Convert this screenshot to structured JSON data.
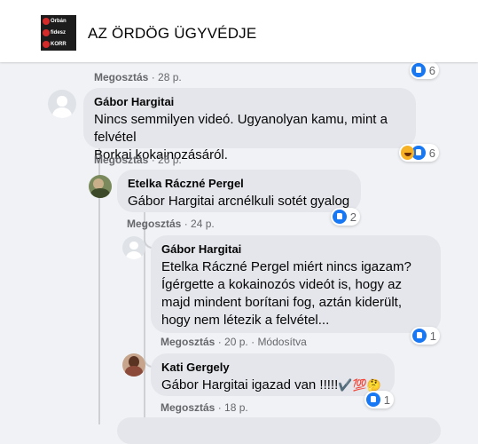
{
  "header": {
    "title": "AZ ÖRDÖG ÜGYVÉDJE",
    "logo_texts": [
      "Orbán",
      "fidesz",
      "KORR"
    ]
  },
  "comments": [
    {
      "meta": {
        "action": "Megosztás",
        "time": "28 p."
      },
      "reactions": {
        "count": "6"
      }
    },
    {
      "author": "Gábor Hargitai",
      "lines": [
        "Nincs semmilyen videó. Ugyanolyan kamu, mint a felvétel",
        "Borkai kokainozásáról."
      ],
      "meta": {
        "action": "Megosztás",
        "time": "26 p."
      },
      "reactions": {
        "count": "6"
      }
    },
    {
      "author": "Etelka Ráczné Pergel",
      "lines": [
        "Gábor Hargitai arcnélkuli sotét gyalog"
      ],
      "meta": {
        "action": "Megosztás",
        "time": "24 p."
      },
      "reactions": {
        "count": "2"
      }
    },
    {
      "author": "Gábor Hargitai",
      "lines": [
        "Etelka Ráczné Pergel miért nincs igazam?",
        "Ígérgette a kokainozós videót is, hogy az",
        "majd mindent borítani fog, aztán kiderült,",
        "hogy nem létezik a felvétel..."
      ],
      "meta": {
        "action": "Megosztás",
        "time": "20 p.",
        "edited": "Módosítva"
      },
      "reactions": {
        "count": "1"
      }
    },
    {
      "author": "Kati Gergely",
      "text": "Gábor Hargitai igazad van !!!!!",
      "emojis": "✔️💯🤔",
      "meta": {
        "action": "Megosztás",
        "time": "18 p."
      },
      "reactions": {
        "count": "1"
      }
    }
  ],
  "separator": "·"
}
